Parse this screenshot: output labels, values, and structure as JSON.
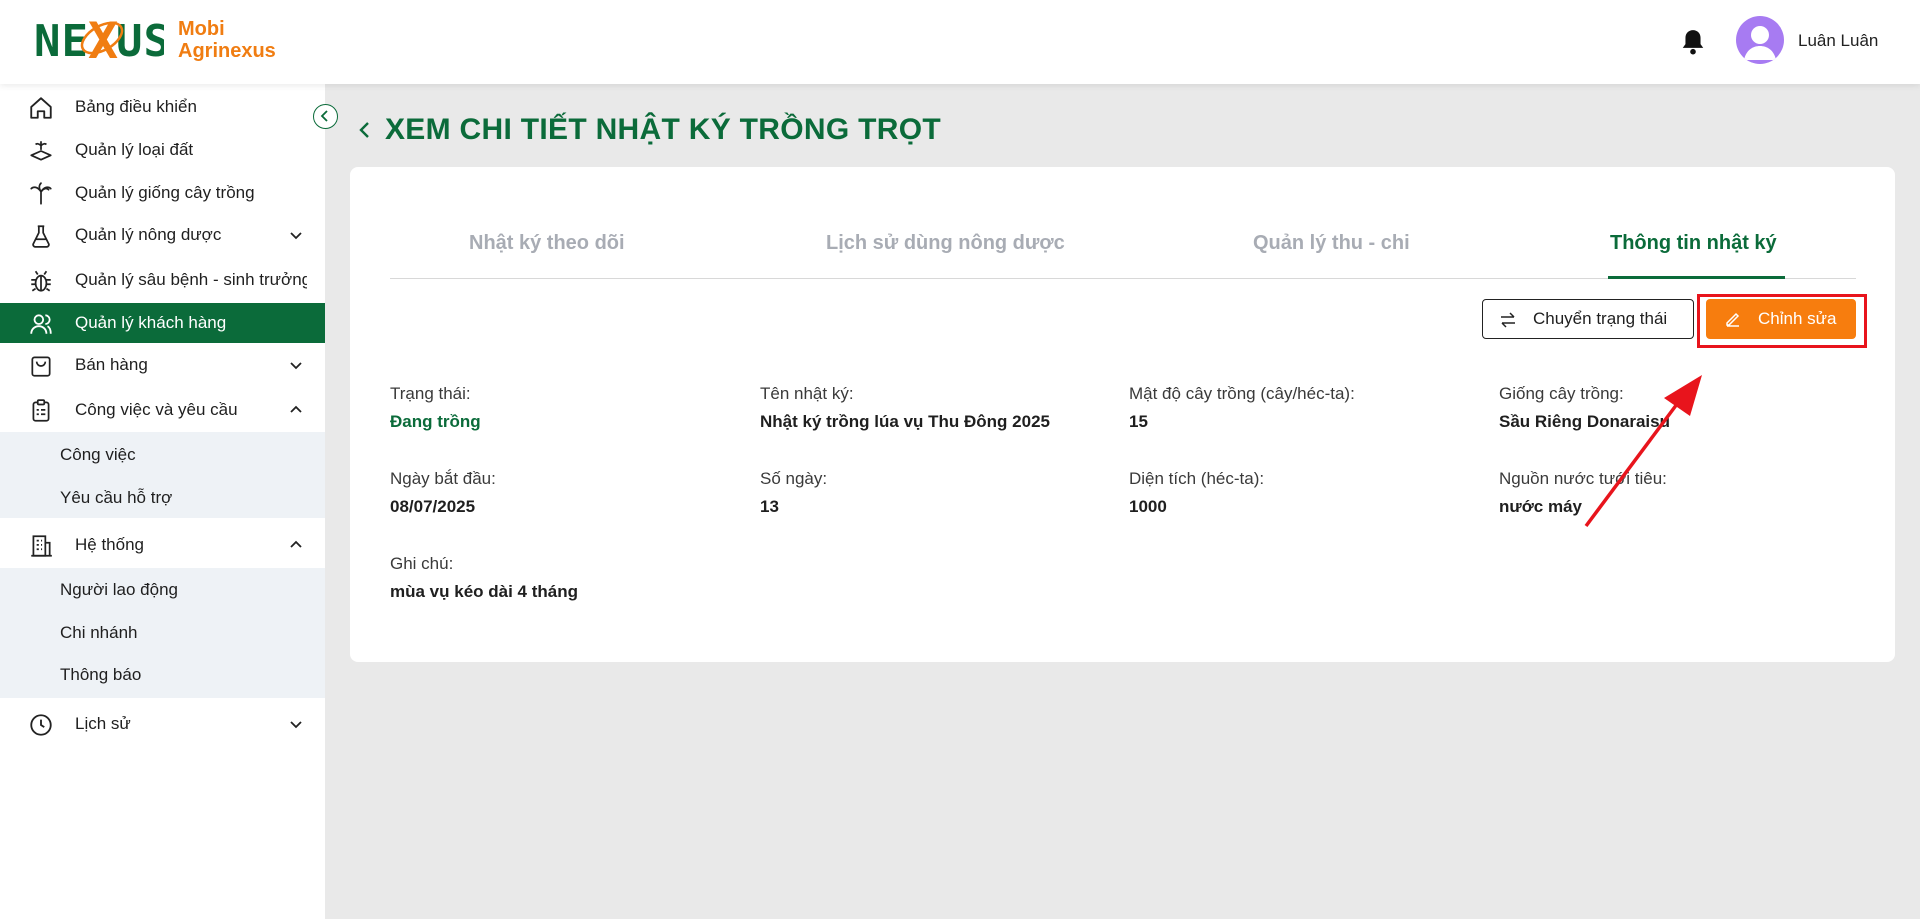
{
  "header": {
    "logo_text": "NEXUS",
    "brand_line1": "Mobi",
    "brand_line2": "Agrinexus",
    "notifications_icon": "bell-icon",
    "user_name": "Luân Luân",
    "avatar_icon": "user-avatar-icon"
  },
  "sidebar": {
    "items": [
      {
        "label": "Bảng điều khiển",
        "icon": "home-icon"
      },
      {
        "label": "Quản lý loại đất",
        "icon": "soil-icon"
      },
      {
        "label": "Quản lý giống cây trồng",
        "icon": "palm-tree-icon"
      },
      {
        "label": "Quản lý nông dược",
        "icon": "flask-icon"
      },
      {
        "label": "Quản lý sâu bệnh - sinh trưởng",
        "icon": "bug-icon"
      },
      {
        "label": "Quản lý khách hàng",
        "icon": "users-icon"
      },
      {
        "label": "Bán hàng",
        "icon": "shopping-bag-icon"
      },
      {
        "label": "Công việc và yêu cầu",
        "icon": "clipboard-icon"
      },
      {
        "label": "Hệ thống",
        "icon": "building-icon"
      },
      {
        "label": "Lịch sử",
        "icon": "clock-icon"
      }
    ],
    "work_sub": [
      "Công việc",
      "Yêu cầu hỗ trợ"
    ],
    "system_sub": [
      "Người lao động",
      "Chi nhánh",
      "Thông báo"
    ]
  },
  "page": {
    "title": "XEM CHI TIẾT NHẬT KÝ TRỒNG TRỌT"
  },
  "tabs": [
    {
      "label": "Nhật ký theo dõi",
      "active": false
    },
    {
      "label": "Lịch sử dùng nông dược",
      "active": false
    },
    {
      "label": "Quản lý thu - chi",
      "active": false
    },
    {
      "label": "Thông tin nhật ký",
      "active": true
    }
  ],
  "actions": {
    "change_status": "Chuyển trạng thái",
    "edit": "Chỉnh sửa"
  },
  "details": {
    "status_label": "Trạng thái:",
    "status_value": "Đang trồng",
    "name_label": "Tên nhật ký:",
    "name_value": "Nhật ký trồng lúa vụ Thu Đông 2025",
    "density_label": "Mật độ cây trồng (cây/héc-ta):",
    "density_value": "15",
    "variety_label": "Giống cây trồng:",
    "variety_value": "Sầu Riêng Donaraisu",
    "start_label": "Ngày bắt đầu:",
    "start_value": "08/07/2025",
    "days_label": "Số ngày:",
    "days_value": "13",
    "area_label": "Diện tích (héc-ta):",
    "area_value": "1000",
    "water_label": "Nguồn nước tưới tiêu:",
    "water_value": "nước máy",
    "note_label": "Ghi chú:",
    "note_value": "mùa vụ kéo dài 4 tháng"
  },
  "colors": {
    "primary": "#0b6b3a",
    "accent": "#f77d0e",
    "highlight": "#e8141c"
  }
}
